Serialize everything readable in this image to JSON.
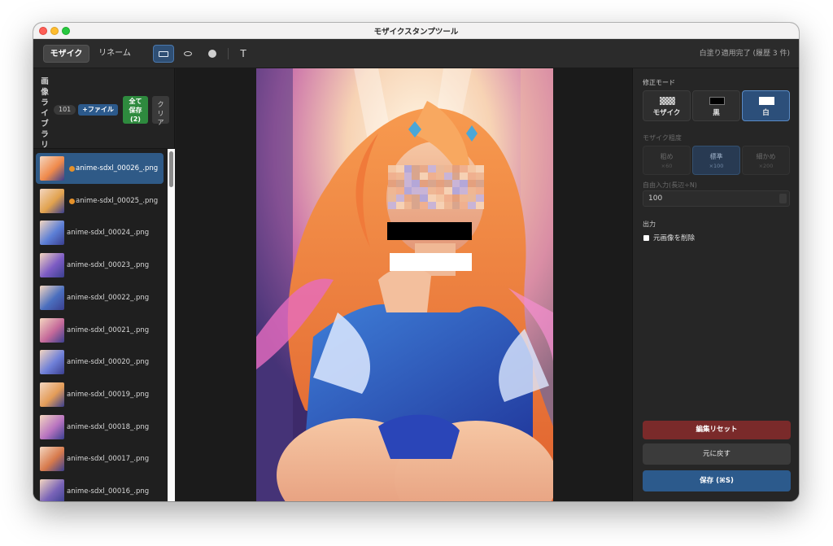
{
  "window": {
    "title": "モザイクスタンプツール"
  },
  "toolbar": {
    "tab_mosaic": "モザイク",
    "tab_rename": "リネーム",
    "tools": [
      "rect-tool-icon",
      "ellipse-tool-icon",
      "brush-dot-icon",
      "text-tool-icon"
    ],
    "text_tool_glyph": "T",
    "status": "白塗り適用完了 (履歴 3 件)"
  },
  "library": {
    "title_chars": [
      "画",
      "像",
      "ラ",
      "イ",
      "ブ",
      "ラ",
      "リ"
    ],
    "count": "101",
    "add_file": "+ファイル",
    "save_all_lines": [
      "全て",
      "保存",
      "(2)"
    ],
    "clear_lines": [
      "ク",
      "リ",
      "ア"
    ],
    "files": [
      {
        "name": "anime-sdxl_00026_.png",
        "modified": true,
        "selected": true
      },
      {
        "name": "anime-sdxl_00025_.png",
        "modified": true,
        "selected": false
      },
      {
        "name": "anime-sdxl_00024_.png",
        "modified": false,
        "selected": false
      },
      {
        "name": "anime-sdxl_00023_.png",
        "modified": false,
        "selected": false
      },
      {
        "name": "anime-sdxl_00022_.png",
        "modified": false,
        "selected": false
      },
      {
        "name": "anime-sdxl_00021_.png",
        "modified": false,
        "selected": false
      },
      {
        "name": "anime-sdxl_00020_.png",
        "modified": false,
        "selected": false
      },
      {
        "name": "anime-sdxl_00019_.png",
        "modified": false,
        "selected": false
      },
      {
        "name": "anime-sdxl_00018_.png",
        "modified": false,
        "selected": false
      },
      {
        "name": "anime-sdxl_00017_.png",
        "modified": false,
        "selected": false
      },
      {
        "name": "anime-sdxl_00016_.png",
        "modified": false,
        "selected": false
      }
    ]
  },
  "panel": {
    "mode_label": "修正モード",
    "modes": [
      {
        "label": "モザイク",
        "icon": "checker-icon",
        "active": false
      },
      {
        "label": "黒",
        "icon": "black-swatch-icon",
        "active": false
      },
      {
        "label": "白",
        "icon": "white-swatch-icon",
        "active": true
      }
    ],
    "coarseness_label": "モザイク粗度",
    "coarseness": [
      {
        "label": "粗め",
        "value": "×60",
        "active": false
      },
      {
        "label": "標準",
        "value": "×100",
        "active": true
      },
      {
        "label": "細かめ",
        "value": "×200",
        "active": false
      }
    ],
    "free_input_label": "自由入力(長辺÷N)",
    "free_input_value": "100",
    "output_label": "出力",
    "delete_original_label": "元画像を削除",
    "reset_button": "編集リセット",
    "undo_button": "元に戻す",
    "save_button": "保存 (⌘S)"
  },
  "colors": {
    "accent_blue": "#2c5a8c",
    "save_green": "#2e8a3e",
    "reset_red": "#7a2a2a",
    "modified_dot": "#e5912a"
  }
}
